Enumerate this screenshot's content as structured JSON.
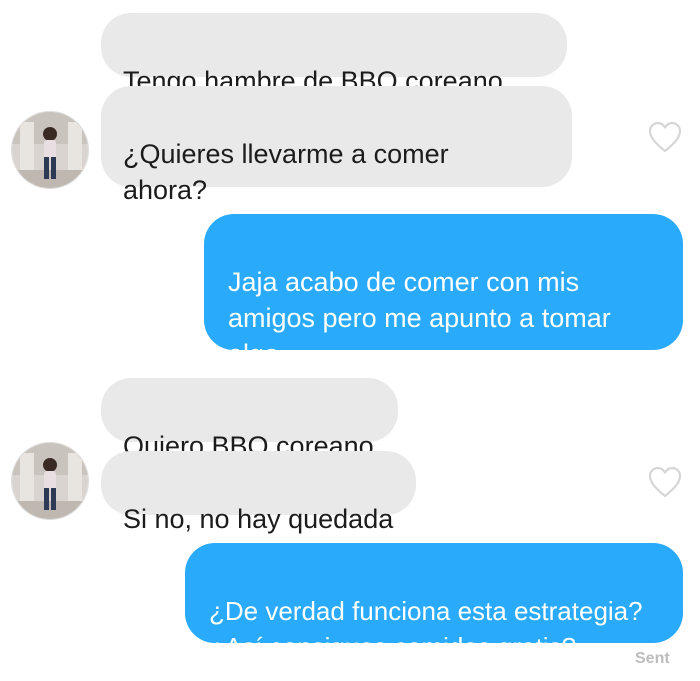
{
  "conversation": {
    "group1": {
      "msg1": "Tengo hambre de BBQ coreano",
      "msg2": "¿Quieres llevarme a comer\nahora?"
    },
    "reply1": "Jaja acabo de comer con mis\namigos pero me apunto a tomar\nalgo",
    "group2": {
      "msg1": "Quiero BBQ coreano",
      "msg2": "Si no, no hay quedada"
    },
    "reply2": "¿De verdad funciona esta estrategia?\n¿Así consigues comidas gratis?",
    "status": "Sent"
  },
  "icons": {
    "avatar": "contact-avatar-photo",
    "like": "heart-outline-icon"
  },
  "colors": {
    "incoming_bubble": "#e9e9ea",
    "outgoing_bubble": "#29aafb",
    "incoming_text": "#1c1c1c",
    "outgoing_text": "#ffffff",
    "heart_stroke": "#d6d6d6",
    "status_text": "#bdbdbd"
  }
}
